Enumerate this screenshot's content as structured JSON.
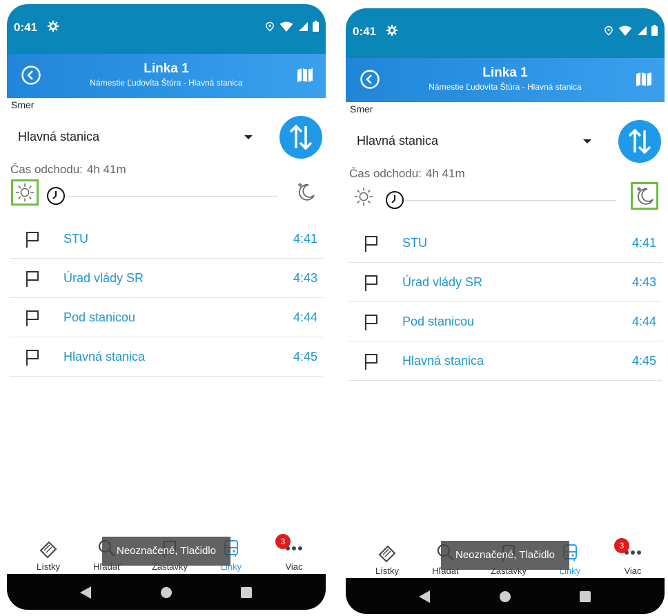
{
  "screens": [
    {
      "status": {
        "time": "0:41"
      },
      "header": {
        "title": "Linka 1",
        "subtitle": "Námestie Ľudovíta Štúra - Hlavná stanica"
      },
      "direction": {
        "label": "Smer",
        "value": "Hlavná stanica"
      },
      "departure": {
        "label": "Čas odchodu:",
        "value": "4h 41m"
      },
      "highlight": "sun",
      "stops": [
        {
          "name": "STU",
          "time": "4:41"
        },
        {
          "name": "Úrad vlády SR",
          "time": "4:43"
        },
        {
          "name": "Pod stanicou",
          "time": "4:44"
        },
        {
          "name": "Hlavná stanica",
          "time": "4:45"
        }
      ],
      "tabs": [
        "Lístky",
        "Hľadať",
        "Zastávky",
        "Linky",
        "Viac"
      ],
      "badge": "3",
      "toast": "Neoznačené, Tlačidlo"
    },
    {
      "status": {
        "time": "0:41"
      },
      "header": {
        "title": "Linka 1",
        "subtitle": "Námestie Ľudovíta Štúra - Hlavná stanica"
      },
      "direction": {
        "label": "Smer",
        "value": "Hlavná stanica"
      },
      "departure": {
        "label": "Čas odchodu:",
        "value": "4h 41m"
      },
      "highlight": "moon",
      "stops": [
        {
          "name": "STU",
          "time": "4:41"
        },
        {
          "name": "Úrad vlády SR",
          "time": "4:43"
        },
        {
          "name": "Pod stanicou",
          "time": "4:44"
        },
        {
          "name": "Hlavná stanica",
          "time": "4:45"
        }
      ],
      "tabs": [
        "Lístky",
        "Hľadať",
        "Zastávky",
        "Linky",
        "Viac"
      ],
      "badge": "3",
      "toast": "Neoznačené, Tlačidlo"
    }
  ],
  "active_tab": "Linky",
  "colors": {
    "status_bar": "#0b86b8",
    "app_bar": "#1f86d9",
    "accent": "#1f95d0",
    "highlight_border": "#6abf3f",
    "badge": "#e01b1b"
  },
  "icons": {
    "status": [
      "gear-icon",
      "location-icon",
      "wifi-icon",
      "signal-icon",
      "battery-icon"
    ],
    "header": [
      "back-arrow-icon",
      "map-icon"
    ],
    "controls": [
      "swap-direction-icon",
      "sun-icon",
      "clock-icon",
      "moon-icon"
    ],
    "stops": "flag-icon",
    "tabs": [
      "ticket-icon",
      "search-icon",
      "stop-sign-icon",
      "bus-icon",
      "more-icon"
    ],
    "system": [
      "back-triangle-icon",
      "home-circle-icon",
      "recents-square-icon"
    ]
  }
}
